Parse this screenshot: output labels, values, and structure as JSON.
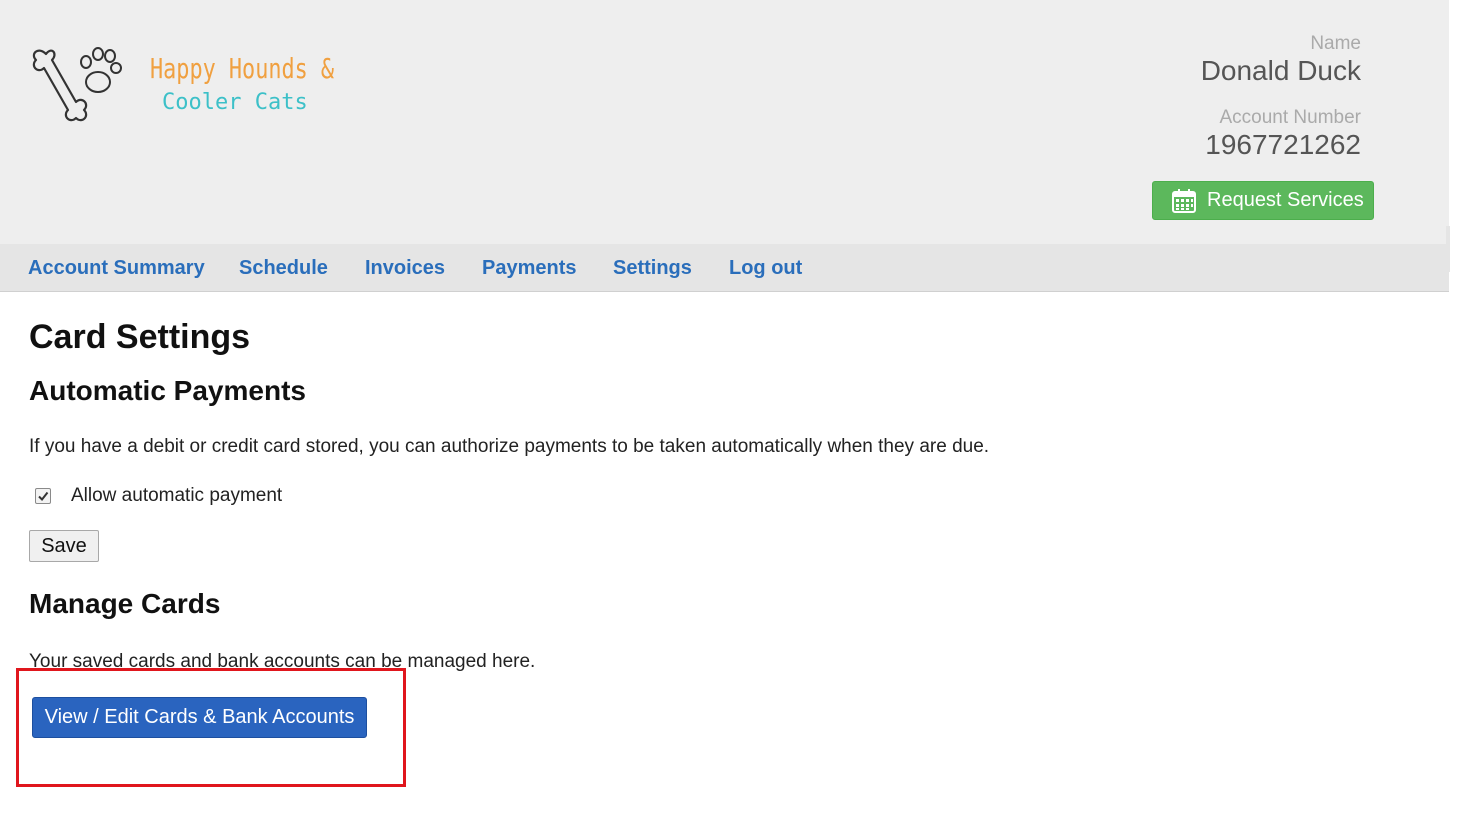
{
  "brand": {
    "logo_line1": "Happy Hounds &",
    "logo_line2": "Cooler Cats",
    "logo_icon": "bone-paw-icon",
    "colors": {
      "orange": "#f0a040",
      "teal": "#3cc0c8"
    }
  },
  "account": {
    "name_label": "Name",
    "name_value": "Donald Duck",
    "number_label": "Account Number",
    "number_value": "1967721262"
  },
  "request_button": {
    "label": "Request Services",
    "icon": "calendar-icon",
    "color": "#5cb85c"
  },
  "nav": {
    "items": [
      {
        "label": "Account Summary"
      },
      {
        "label": "Schedule"
      },
      {
        "label": "Invoices"
      },
      {
        "label": "Payments"
      },
      {
        "label": "Settings"
      },
      {
        "label": "Log out"
      }
    ],
    "color": "#2a6ebb"
  },
  "main": {
    "title": "Card Settings",
    "automatic": {
      "heading": "Automatic Payments",
      "description": "If you have a debit or credit card stored, you can authorize payments to be taken automatically when they are due.",
      "checkbox_label": "Allow automatic payment",
      "checkbox_checked": true,
      "save_label": "Save"
    },
    "manage": {
      "heading": "Manage Cards",
      "description": "Your saved cards and bank accounts can be managed here.",
      "button_label": "View / Edit Cards & Bank Accounts",
      "button_color": "#2a64bf"
    }
  },
  "annotation": {
    "highlight_color": "#e0161d"
  }
}
